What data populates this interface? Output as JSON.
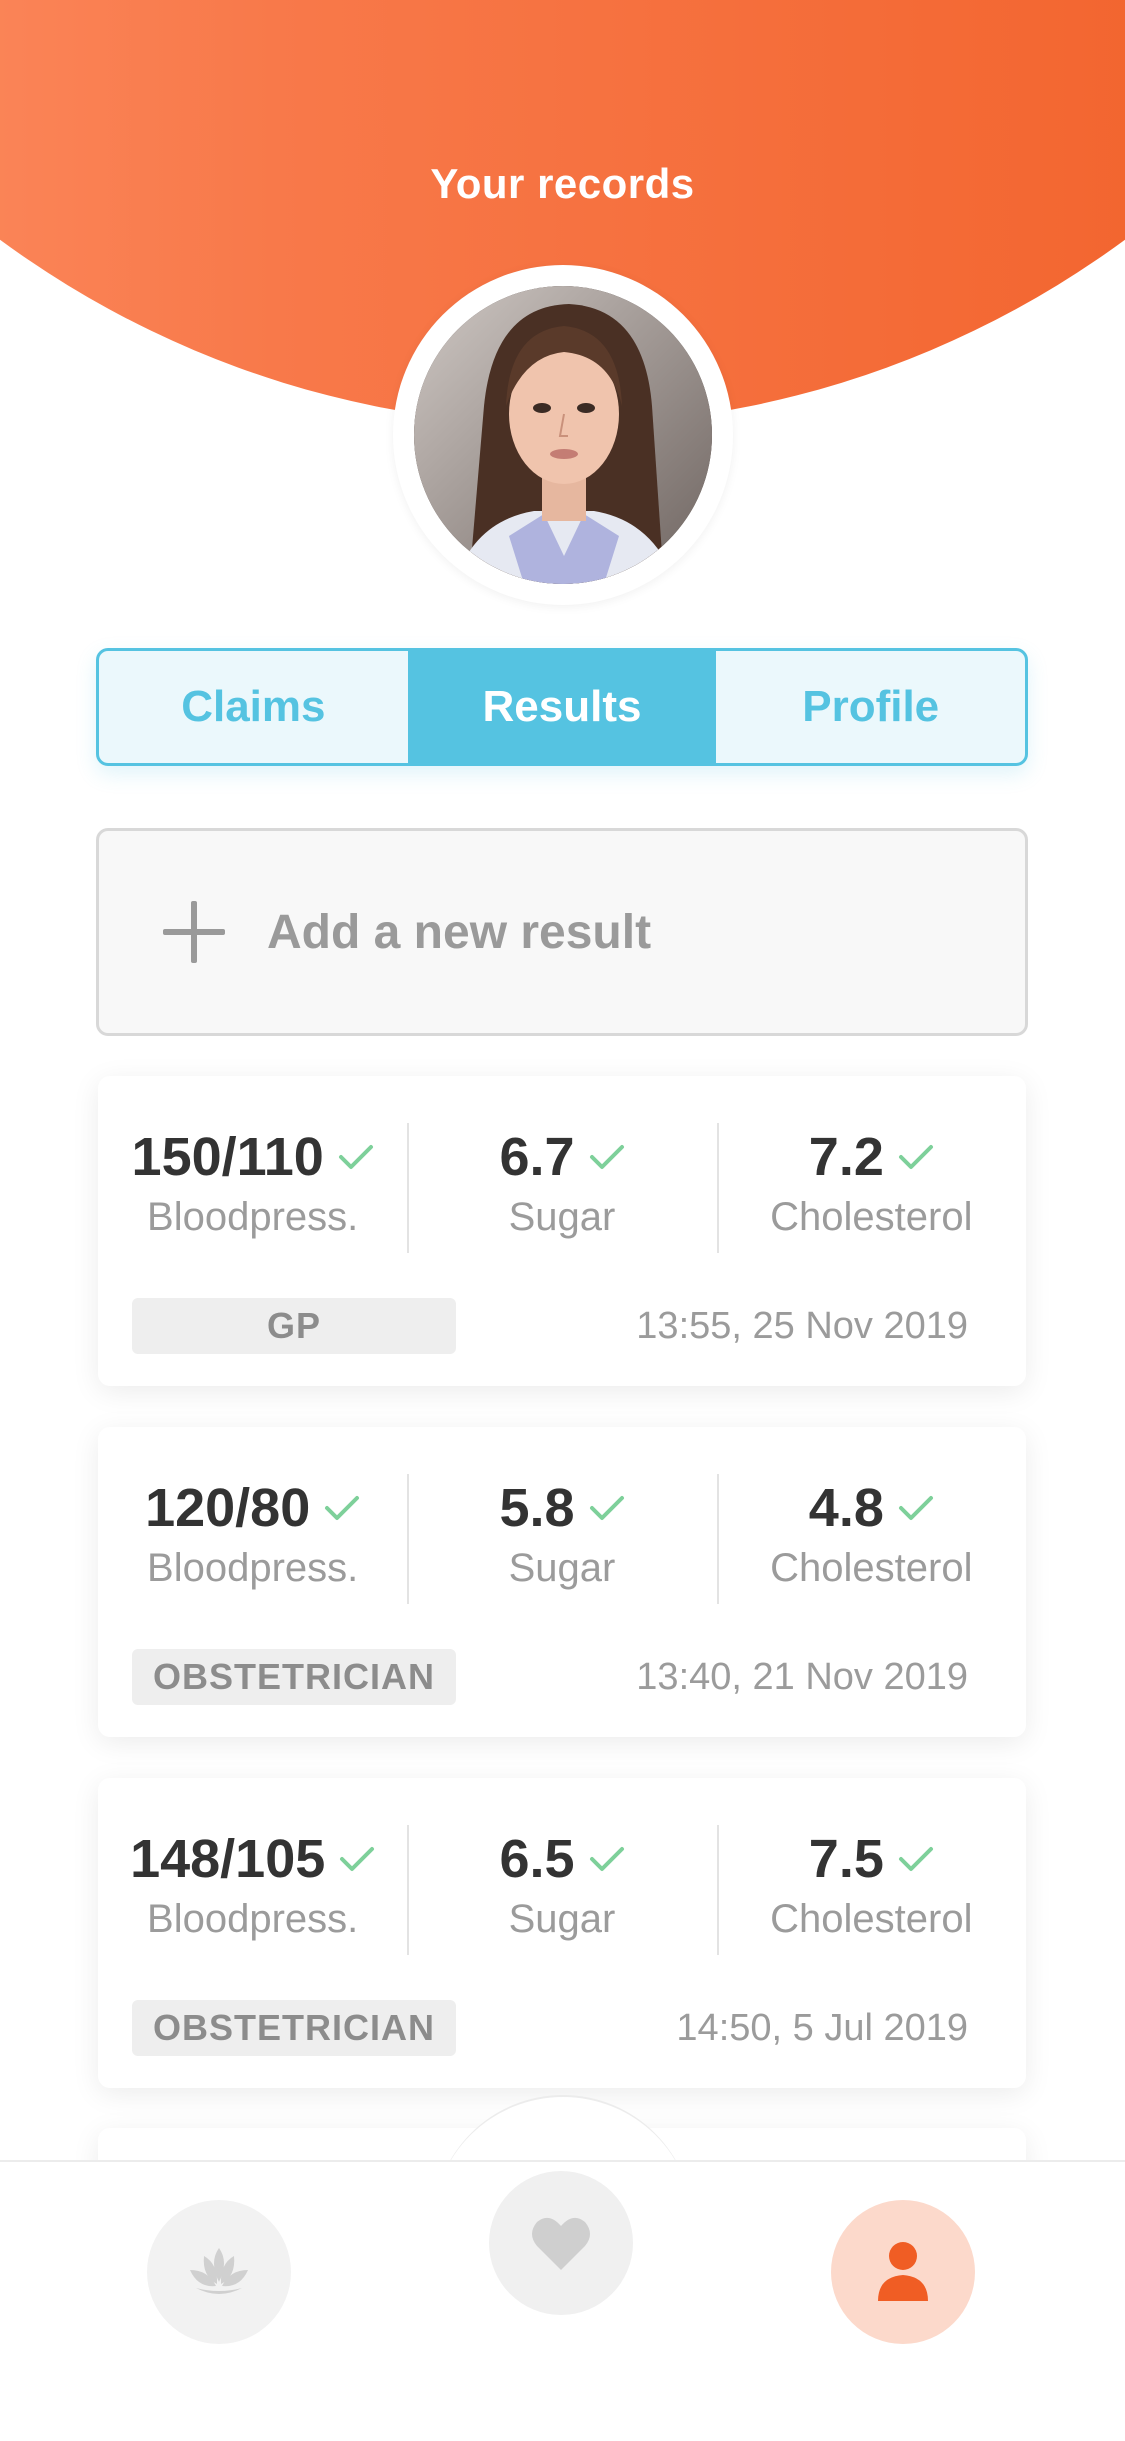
{
  "header": {
    "title": "Your records"
  },
  "tabs": [
    {
      "label": "Claims",
      "active": false
    },
    {
      "label": "Results",
      "active": true
    },
    {
      "label": "Profile",
      "active": false
    }
  ],
  "add_result": {
    "label": "Add a new result",
    "icon": "plus-icon"
  },
  "results": [
    {
      "bloodpressure": "150/110",
      "sugar": "6.7",
      "cholesterol": "7.2",
      "labels": {
        "bp": "Bloodpress.",
        "sugar": "Sugar",
        "chol": "Cholesterol"
      },
      "tag": "GP",
      "timestamp": "13:55, 25 Nov 2019"
    },
    {
      "bloodpressure": "120/80",
      "sugar": "5.8",
      "cholesterol": "4.8",
      "labels": {
        "bp": "Bloodpress.",
        "sugar": "Sugar",
        "chol": "Cholesterol"
      },
      "tag": "OBSTETRICIAN",
      "timestamp": "13:40, 21 Nov 2019"
    },
    {
      "bloodpressure": "148/105",
      "sugar": "6.5",
      "cholesterol": "7.5",
      "labels": {
        "bp": "Bloodpress.",
        "sugar": "Sugar",
        "chol": "Cholesterol"
      },
      "tag": "OBSTETRICIAN",
      "timestamp": "14:50, 5 Jul 2019"
    }
  ],
  "bottom_nav": [
    {
      "icon": "lotus-icon",
      "active": false
    },
    {
      "icon": "heart-icon",
      "active": false
    },
    {
      "icon": "user-icon",
      "active": true
    }
  ],
  "colors": {
    "header_gradient_start": "#fe9369",
    "header_gradient_end": "#f05d24",
    "accent_blue": "#55c3e1",
    "check_green": "#7ed09a",
    "active_orange": "#f05d24"
  }
}
